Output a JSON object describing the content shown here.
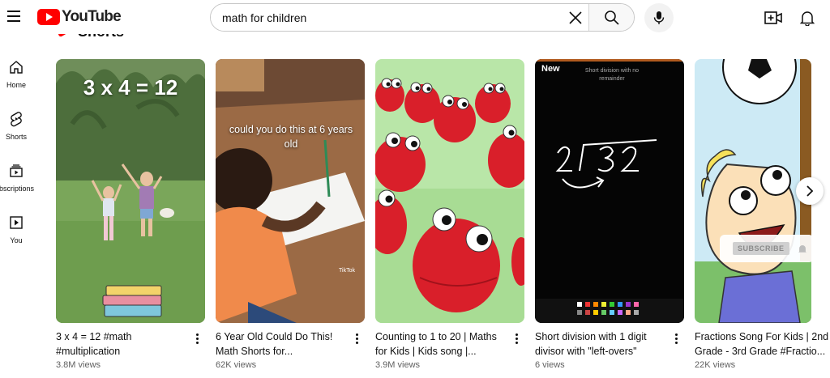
{
  "header": {
    "logo_text": "YouTube",
    "search": {
      "value": "math for children",
      "placeholder": "Search"
    }
  },
  "sidebar": {
    "items": [
      {
        "label": "Home",
        "icon": "home-icon"
      },
      {
        "label": "Shorts",
        "icon": "shorts-icon"
      },
      {
        "label": "Subscriptions",
        "icon": "subscriptions-icon"
      },
      {
        "label": "You",
        "icon": "you-icon"
      }
    ]
  },
  "shorts": {
    "title": "Shorts",
    "cards": [
      {
        "title": "3 x 4 = 12 #math #multiplication",
        "views": "3.8M views",
        "caption": "3 x 4 = 12"
      },
      {
        "title": "6 Year Old Could Do This! Math Shorts for...",
        "views": "62K views",
        "caption": "could you do this at 6 years old",
        "watermark": "TikTok"
      },
      {
        "title": "Counting to 1 to 20 | Maths for Kids | Kids song |...",
        "views": "3.9M views"
      },
      {
        "title": "Short division with 1 digit divisor with \"left-overs\"",
        "views": "6 views",
        "badge": "New",
        "caption": "Short division with no remainder",
        "board_text": "2 | 32"
      },
      {
        "title": "Fractions Song For Kids | 2nd Grade - 3rd Grade #Fractio...",
        "views": "22K views"
      }
    ],
    "subscribe_label": "SUBSCRIBE"
  },
  "colors": {
    "brand_red": "#ff0000",
    "text_primary": "#0f0f0f",
    "text_secondary": "#606060"
  }
}
